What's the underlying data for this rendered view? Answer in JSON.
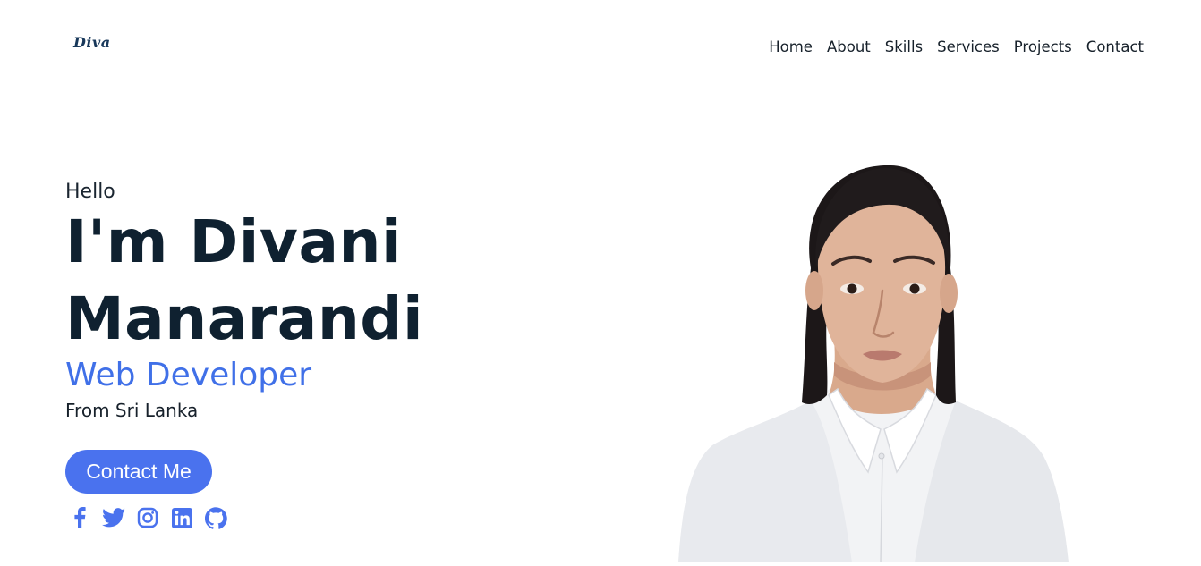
{
  "header": {
    "logo": "Diva",
    "nav": [
      "Home",
      "About",
      "Skills",
      "Services",
      "Projects",
      "Contact"
    ]
  },
  "hero": {
    "greeting": "Hello",
    "name_line1": "I'm Divani",
    "name_line2": "Manarandi",
    "role": "Web Developer",
    "location": "From Sri Lanka",
    "cta_label": "Contact Me"
  },
  "socials": [
    {
      "icon": "facebook-icon"
    },
    {
      "icon": "twitter-icon"
    },
    {
      "icon": "instagram-icon"
    },
    {
      "icon": "linkedin-icon"
    },
    {
      "icon": "github-icon"
    }
  ],
  "colors": {
    "accent": "#4a72ee",
    "role_text": "#4070e8",
    "heading": "#0f2130",
    "icon": "#4a72ee"
  }
}
